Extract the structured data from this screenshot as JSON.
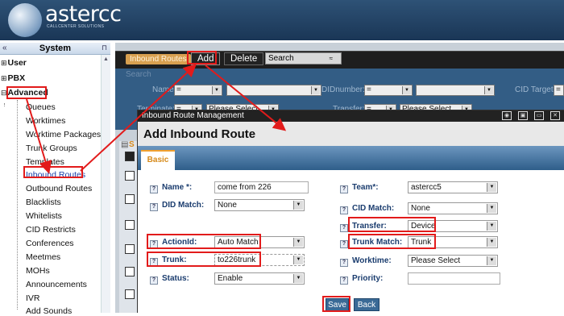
{
  "brand": {
    "name": "astercc",
    "tagline": "CALLCENTER SOLUTIONS"
  },
  "sidebar": {
    "collapse": "«",
    "title": "System",
    "pin": "⊓",
    "top_items": [
      {
        "toggle": "⊞",
        "label": "User"
      },
      {
        "toggle": "⊞",
        "label": "PBX"
      },
      {
        "toggle": "⊟",
        "label": "Advanced"
      }
    ],
    "items": [
      "Queues",
      "Worktimes",
      "Worktime Packages",
      "Trunk Groups",
      "Templates",
      "Inbound Routes",
      "Outbound Routes",
      "Blacklists",
      "Whitelists",
      "CID Restricts",
      "Conferences",
      "Meetmes",
      "MOHs",
      "Announcements",
      "IVR",
      "Add Sounds"
    ]
  },
  "toolbar": {
    "tab": "Inbound Routes",
    "add": "Add",
    "delete": "Delete",
    "search": "Search",
    "search_arrow": "≈"
  },
  "search": {
    "title": "Search",
    "name_label": "Name:",
    "name_op": "=",
    "did_label": "DIDnumber:",
    "did_op": "=",
    "cid_label": "CID Target:",
    "cid_op": "=",
    "terminate_label": "Terminate:",
    "terminate_op": "=",
    "terminate_value": "Please Select",
    "transfer_label": "Transfer:",
    "transfer_op": "=",
    "transfer_value": "Please Select"
  },
  "grid": {
    "partial_label": "S"
  },
  "modal": {
    "bar_title": "Inbound Route Management",
    "title": "Add Inbound Route",
    "tab": "Basic",
    "fields": {
      "name": {
        "label": "Name *:",
        "value": "come from 226"
      },
      "did_match": {
        "label": "DID Match:",
        "value": "None"
      },
      "action_id": {
        "label": "ActionId:",
        "value": "Auto Match"
      },
      "trunk": {
        "label": "Trunk:",
        "value": "to226trunk"
      },
      "status": {
        "label": "Status:",
        "value": "Enable"
      },
      "team": {
        "label": "Team*:",
        "value": "astercc5"
      },
      "cid_match": {
        "label": "CID Match:",
        "value": "None"
      },
      "transfer": {
        "label": "Transfer:",
        "value": "Device"
      },
      "trunk_match": {
        "label": "Trunk Match:",
        "value": "Trunk"
      },
      "worktime": {
        "label": "Worktime:",
        "value": "Please Select"
      },
      "priority": {
        "label": "Priority:",
        "value": ""
      }
    },
    "save": "Save",
    "back": "Back"
  },
  "colors": {
    "highlight": "#e21b1b",
    "header": "#1f3d60",
    "tab_accent": "#d68a1a"
  }
}
